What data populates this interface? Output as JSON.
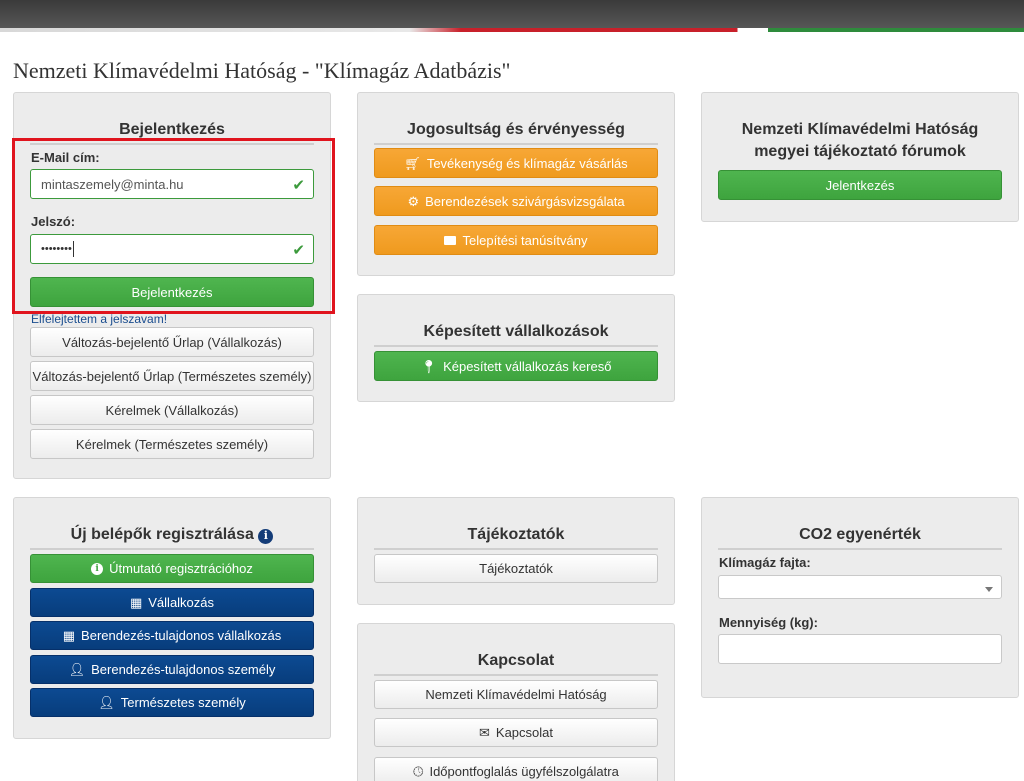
{
  "page_title": "Nemzeti Klímavédelmi Hatóság - \"Klímagáz Adatbázis\"",
  "login": {
    "title": "Bejelentkezés",
    "email_label": "E-Mail cím:",
    "email_value": "mintaszemely@minta.hu",
    "password_label": "Jelszó:",
    "password_value": "••••••••",
    "submit_label": "Bejelentkezés",
    "forgot_link": "Elfelejtettem a jelszavam!",
    "buttons": [
      "Változás-bejelentő Űrlap (Vállalkozás)",
      "Változás-bejelentő Űrlap (Természetes személy)",
      "Kérelmek (Vállalkozás)",
      "Kérelmek (Természetes személy)"
    ]
  },
  "rights": {
    "title": "Jogosultság és érvényesség",
    "buttons": [
      {
        "label": "Tevékenység és klímagáz vásárlás",
        "icon": "cart-icon"
      },
      {
        "label": "Berendezések szivárgásvizsgálata",
        "icon": "gear-icon"
      },
      {
        "label": "Telepítési tanúsítvány",
        "icon": "briefcase-icon"
      }
    ]
  },
  "forums": {
    "title_line1": "Nemzeti Klímavédelmi Hatóság",
    "title_line2": "megyei tájékoztató fórumok",
    "button_label": "Jelentkezés"
  },
  "qualified": {
    "title": "Képesített vállalkozások",
    "button_label": "Képesített vállalkozás kereső",
    "icon": "map-marker-icon"
  },
  "registration": {
    "title": "Új belépők regisztrálása",
    "guide_label": "Útmutató regisztrációhoz",
    "buttons": [
      {
        "label": "Vállalkozás",
        "icon": "building-icon"
      },
      {
        "label": "Berendezés-tulajdonos vállalkozás",
        "icon": "building-icon"
      },
      {
        "label": "Berendezés-tulajdonos személy",
        "icon": "user-icon"
      },
      {
        "label": "Természetes személy",
        "icon": "user-icon"
      }
    ]
  },
  "info": {
    "title": "Tájékoztatók",
    "button_label": "Tájékoztatók"
  },
  "contact": {
    "title": "Kapcsolat",
    "buttons": [
      {
        "label": "Nemzeti Klímavédelmi Hatóság",
        "icon": ""
      },
      {
        "label": "Kapcsolat",
        "icon": "envelope-icon"
      },
      {
        "label": "Időpontfoglalás ügyfélszolgálatra",
        "icon": "clock-icon"
      }
    ]
  },
  "co2": {
    "title": "CO2 egyenérték",
    "gas_label": "Klímagáz fajta:",
    "gas_value": "",
    "amount_label": "Mennyiség (kg):",
    "amount_value": ""
  }
}
